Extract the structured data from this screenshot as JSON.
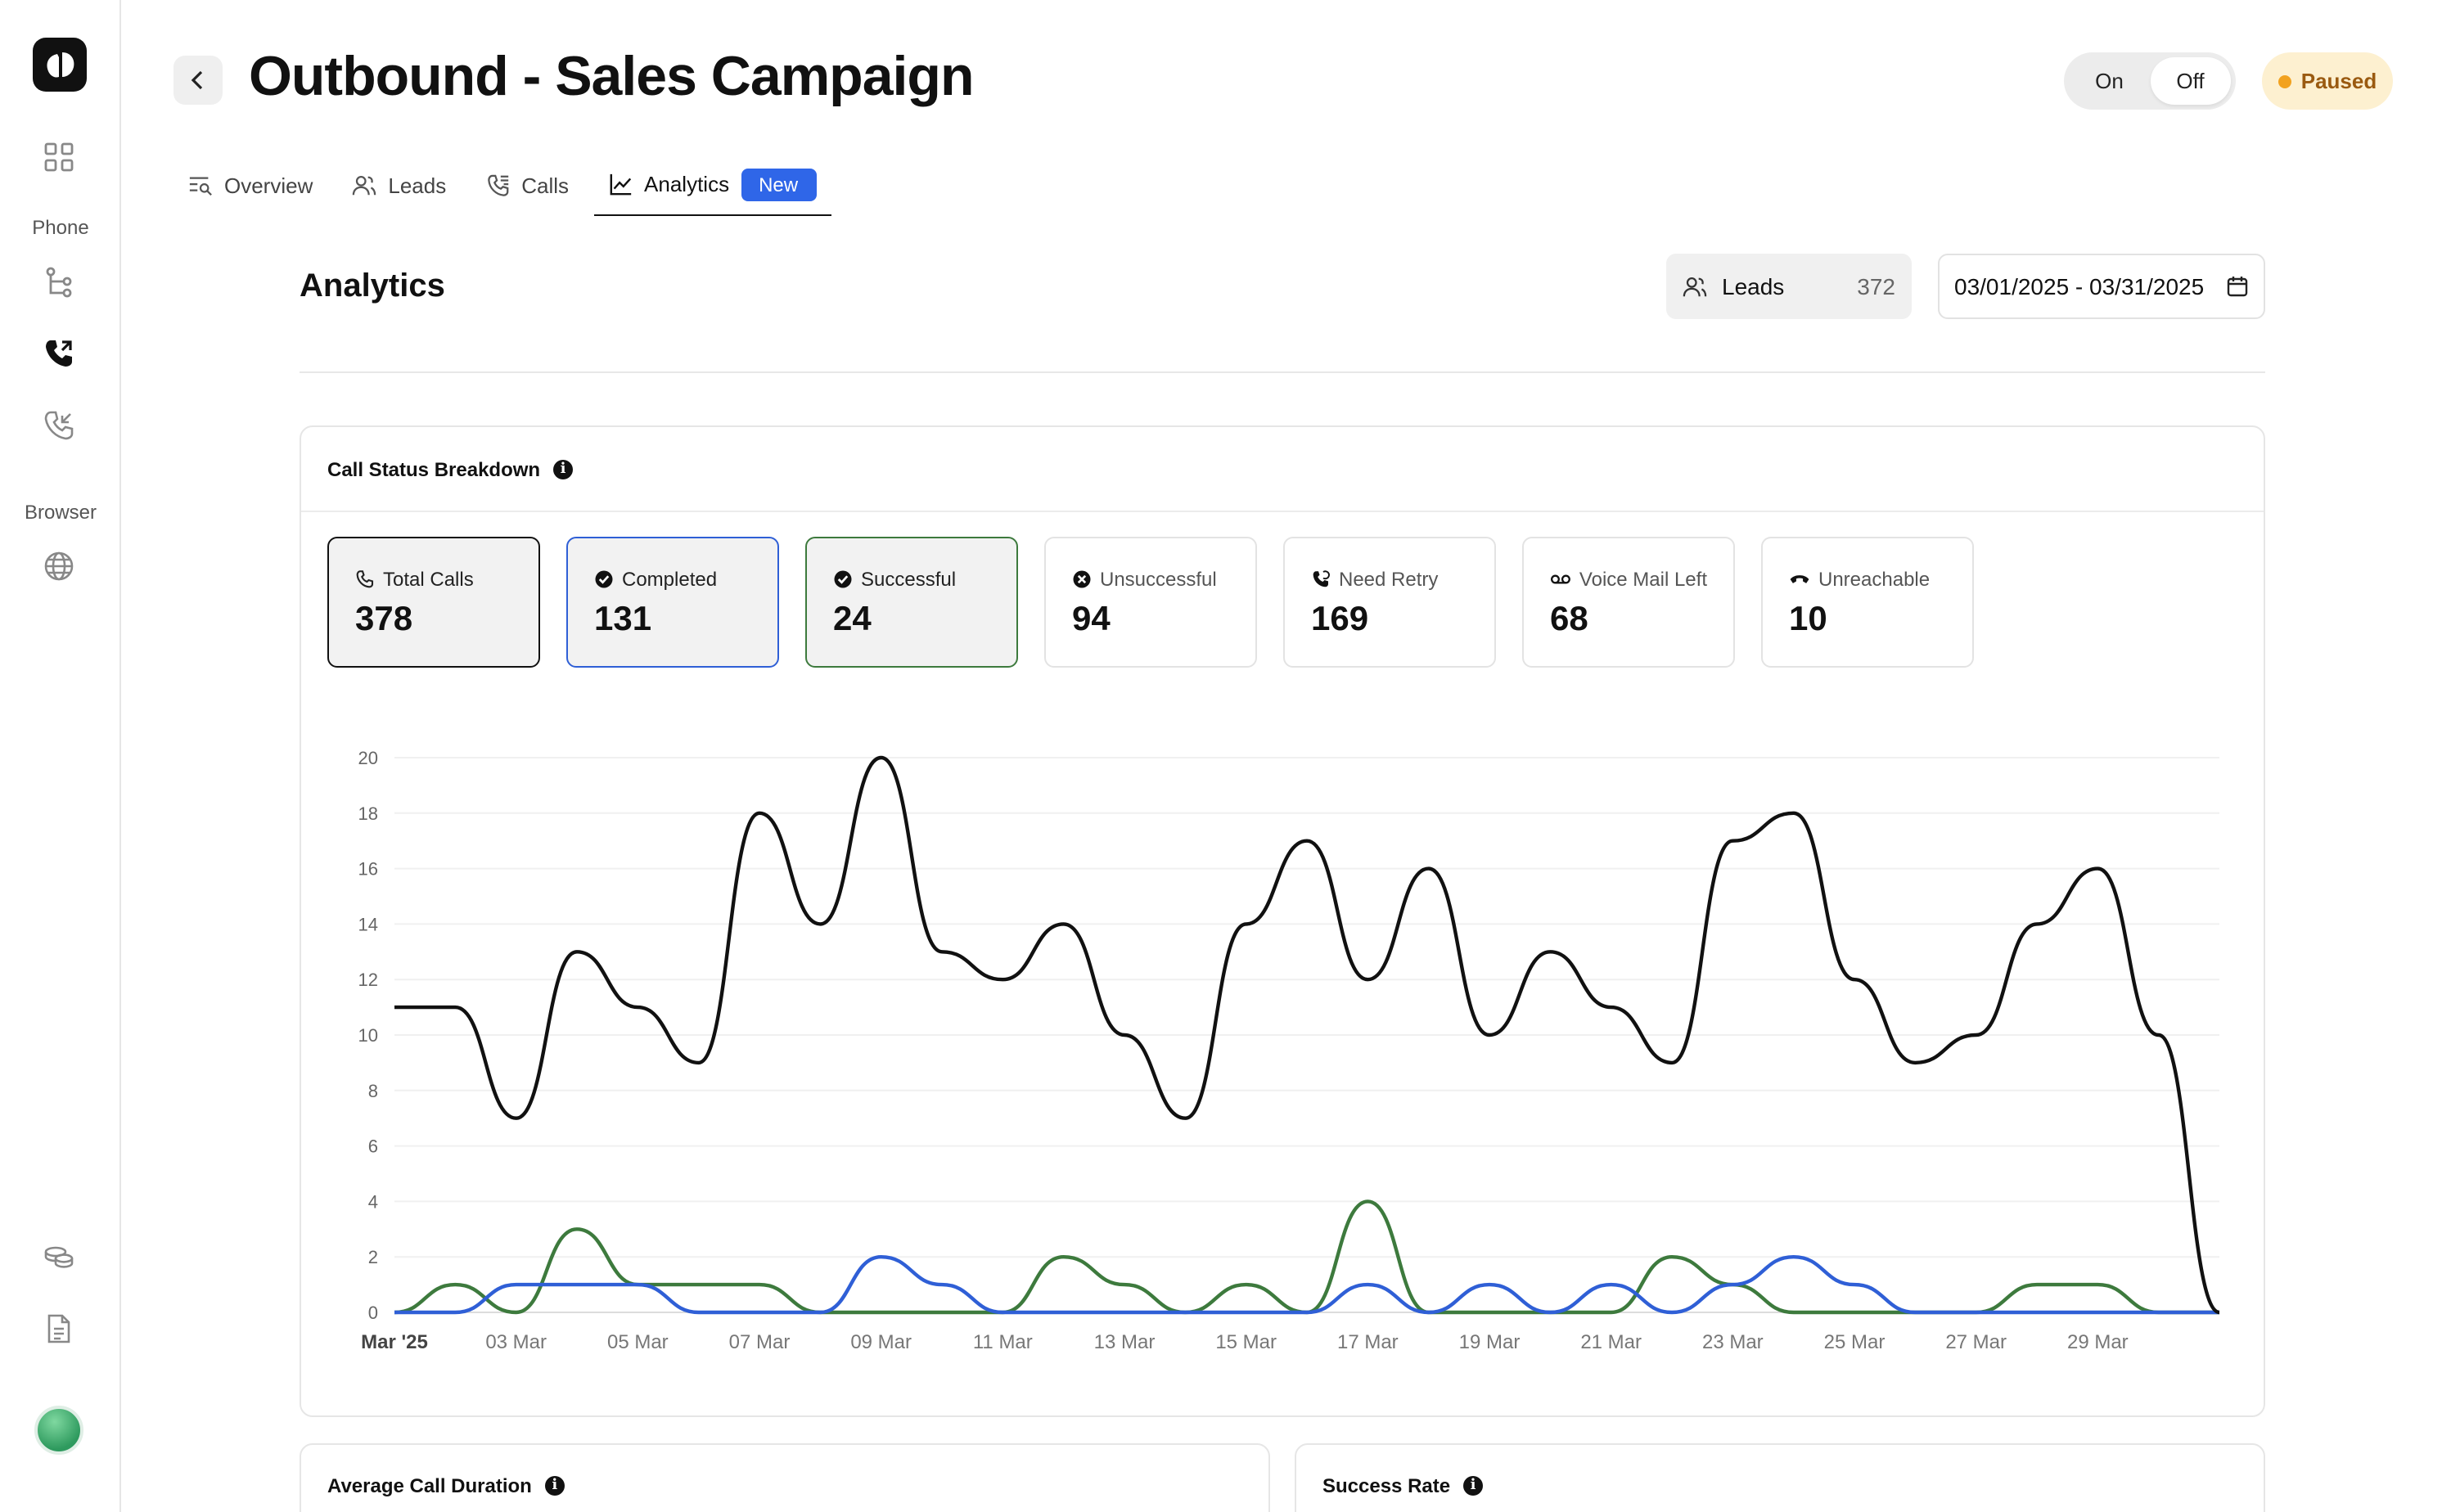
{
  "sidebar": {
    "sections": [
      {
        "label": "Phone"
      },
      {
        "label": "Browser"
      }
    ],
    "icons": [
      "dashboard-grid-icon",
      "flow-icon",
      "phone-outgoing-icon",
      "phone-incoming-icon",
      "globe-icon",
      "coins-icon",
      "document-icon"
    ]
  },
  "header": {
    "title": "Outbound - Sales Campaign",
    "toggle": {
      "on_label": "On",
      "off_label": "Off",
      "selected": "Off"
    },
    "status": "Paused"
  },
  "tabs": [
    {
      "label": "Overview",
      "icon": "overview-icon"
    },
    {
      "label": "Leads",
      "icon": "users-icon"
    },
    {
      "label": "Calls",
      "icon": "phone-list-icon"
    },
    {
      "label": "Analytics",
      "icon": "line-chart-icon",
      "badge": "New",
      "active": true
    }
  ],
  "analytics": {
    "title": "Analytics",
    "leads_filter": {
      "label": "Leads",
      "count": "372"
    },
    "date_range": "03/01/2025 - 03/31/2025"
  },
  "call_status": {
    "title": "Call Status Breakdown",
    "stats": [
      {
        "label": "Total Calls",
        "value": "378",
        "icon": "phone-icon"
      },
      {
        "label": "Completed",
        "value": "131",
        "icon": "check-circle-icon"
      },
      {
        "label": "Successful",
        "value": "24",
        "icon": "check-circle-icon"
      },
      {
        "label": "Unsuccessful",
        "value": "94",
        "icon": "x-circle-icon"
      },
      {
        "label": "Need Retry",
        "value": "169",
        "icon": "phone-retry-icon"
      },
      {
        "label": "Voice Mail Left",
        "value": "68",
        "icon": "voicemail-icon"
      },
      {
        "label": "Unreachable",
        "value": "10",
        "icon": "phone-off-icon"
      }
    ]
  },
  "bottom_cards": {
    "avg_duration": "Average Call Duration",
    "success_rate": "Success Rate"
  },
  "colors": {
    "total": "#111111",
    "completed": "#2f5fd6",
    "successful": "#3d7a3d",
    "accent": "#2f66e8"
  },
  "chart_data": {
    "type": "line",
    "ylim": [
      0,
      20
    ],
    "yticks": [
      0,
      2,
      4,
      6,
      8,
      10,
      12,
      14,
      16,
      18,
      20
    ],
    "x": [
      "Mar '25",
      "02 Mar",
      "03 Mar",
      "04 Mar",
      "05 Mar",
      "06 Mar",
      "07 Mar",
      "08 Mar",
      "09 Mar",
      "10 Mar",
      "11 Mar",
      "12 Mar",
      "13 Mar",
      "14 Mar",
      "15 Mar",
      "16 Mar",
      "17 Mar",
      "18 Mar",
      "19 Mar",
      "20 Mar",
      "21 Mar",
      "22 Mar",
      "23 Mar",
      "24 Mar",
      "25 Mar",
      "26 Mar",
      "27 Mar",
      "28 Mar",
      "29 Mar",
      "30 Mar",
      "31 Mar"
    ],
    "xtick_labels": [
      "Mar '25",
      "03 Mar",
      "05 Mar",
      "07 Mar",
      "09 Mar",
      "11 Mar",
      "13 Mar",
      "15 Mar",
      "17 Mar",
      "19 Mar",
      "21 Mar",
      "23 Mar",
      "25 Mar",
      "27 Mar",
      "29 Mar"
    ],
    "series": [
      {
        "key": "total",
        "values": [
          11,
          11,
          7,
          13,
          11,
          9,
          18,
          14,
          20,
          13,
          12,
          14,
          10,
          7,
          14,
          17,
          12,
          16,
          10,
          13,
          11,
          9,
          17,
          18,
          12,
          9,
          10,
          14,
          16,
          10,
          0
        ]
      },
      {
        "key": "completed",
        "values": [
          0,
          0,
          1,
          1,
          1,
          0,
          0,
          0,
          2,
          1,
          0,
          0,
          0,
          0,
          0,
          0,
          1,
          0,
          1,
          0,
          1,
          0,
          1,
          2,
          1,
          0,
          0,
          0,
          0,
          0,
          0
        ]
      },
      {
        "key": "successful",
        "values": [
          0,
          1,
          0,
          3,
          1,
          1,
          1,
          0,
          0,
          0,
          0,
          2,
          1,
          0,
          1,
          0,
          4,
          0,
          0,
          0,
          0,
          2,
          1,
          0,
          0,
          0,
          0,
          1,
          1,
          0,
          0
        ]
      }
    ]
  }
}
